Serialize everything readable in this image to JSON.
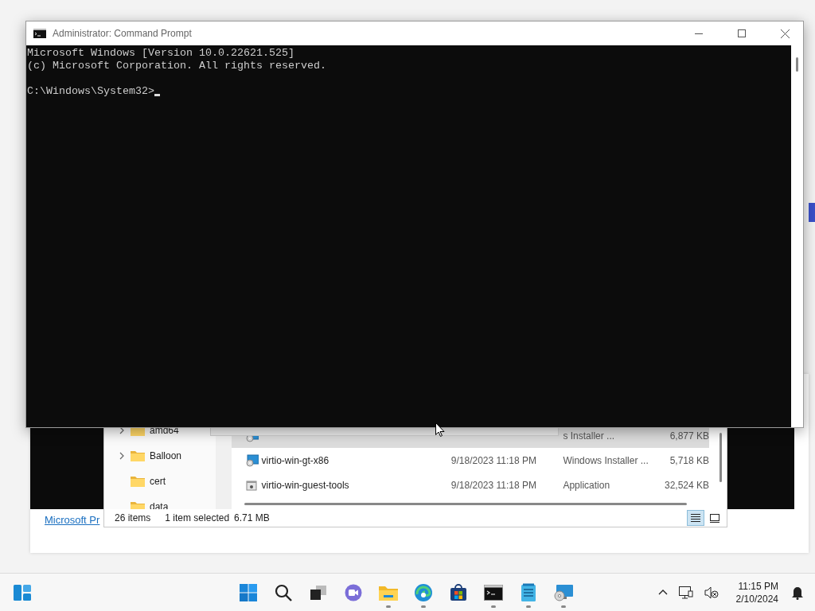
{
  "background_window": {
    "link": "Microsoft Pr"
  },
  "explorer": {
    "nav_items": [
      {
        "label": "amd64",
        "expandable": true
      },
      {
        "label": "Balloon",
        "expandable": true
      },
      {
        "label": "cert",
        "expandable": false
      },
      {
        "label": "data",
        "expandable": false
      }
    ],
    "files": [
      {
        "kind": "installer",
        "type": "s Installer ...",
        "size": "6,877 KB",
        "selected": true
      },
      {
        "kind": "installer",
        "name": "virtio-win-gt-x86",
        "date": "9/18/2023 11:18 PM",
        "type": "Windows Installer ...",
        "size": "5,718 KB",
        "selected": false
      },
      {
        "kind": "application",
        "name": "virtio-win-guest-tools",
        "date": "9/18/2023 11:18 PM",
        "type": "Application",
        "size": "32,524 KB",
        "selected": false
      }
    ],
    "status": {
      "count": "26 items",
      "selection": "1 item selected",
      "size": "6.71 MB"
    },
    "view_buttons": [
      {
        "kind": "details",
        "selected": true
      },
      {
        "kind": "tiles",
        "selected": false
      }
    ]
  },
  "cmd": {
    "title": "Administrator: Command Prompt",
    "lines": [
      "Microsoft Windows [Version 10.0.22621.525]",
      "(c) Microsoft Corporation. All rights reserved."
    ],
    "prompt": "C:\\Windows\\System32>"
  },
  "taskbar": {
    "apps": [
      {
        "kind": "start",
        "running": false
      },
      {
        "kind": "search",
        "running": false
      },
      {
        "kind": "task-view",
        "running": false
      },
      {
        "kind": "chat",
        "running": false
      },
      {
        "kind": "file-explorer",
        "running": true
      },
      {
        "kind": "browser",
        "running": true
      },
      {
        "kind": "store",
        "running": false
      },
      {
        "kind": "terminal",
        "running": true
      },
      {
        "kind": "notepad",
        "running": true
      },
      {
        "kind": "remote-desktop",
        "running": true
      }
    ],
    "clock": {
      "time": "11:15 PM",
      "date": "2/10/2024"
    }
  }
}
